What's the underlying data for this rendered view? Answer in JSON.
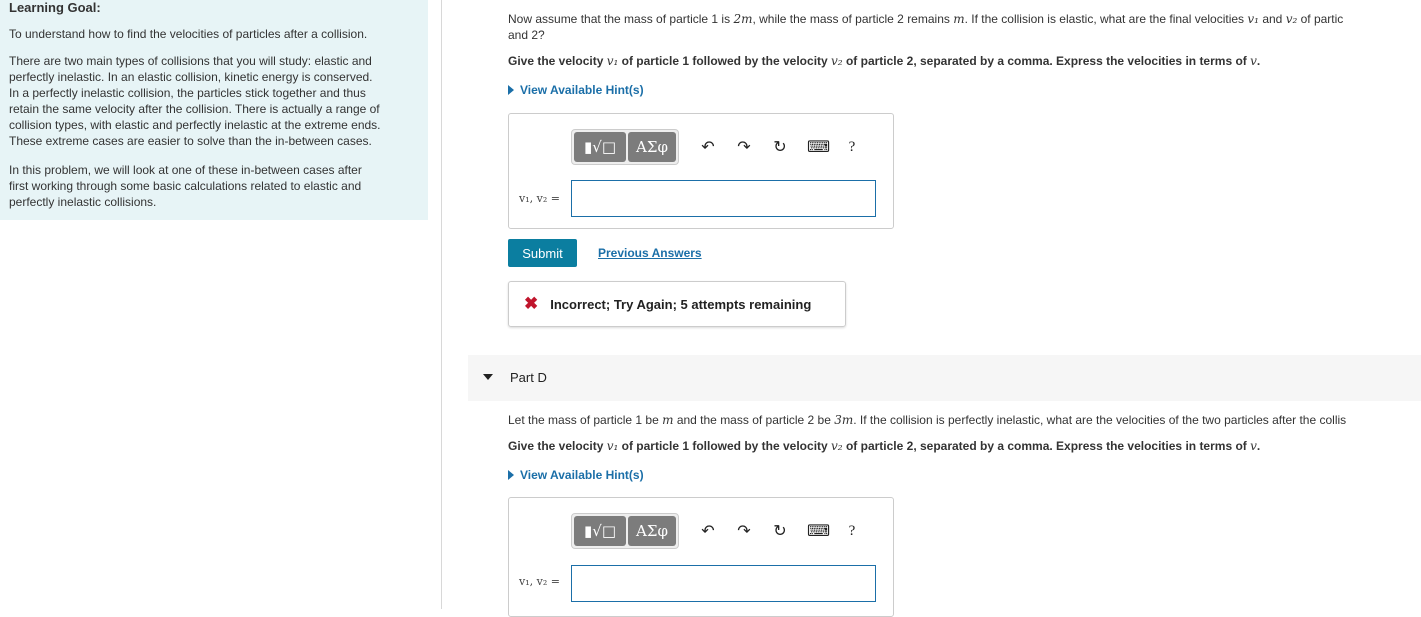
{
  "learning_goal": {
    "title": "Learning Goal:",
    "intro": "To understand how to find the velocities of particles after a collision.",
    "para1_lines": [
      "There are two main types of collisions that you will study: elastic and",
      "perfectly inelastic. In an elastic collision, kinetic energy is conserved.",
      "In a perfectly inelastic collision, the particles stick together and thus",
      "retain the same velocity after the collision. There is actually a range of",
      "collision types, with elastic and perfectly inelastic at the extreme ends.",
      "These extreme cases are easier to solve than the in-between cases."
    ],
    "para2_lines": [
      "In this problem, we will look at one of these in-between cases after",
      "first working through some basic calculations related to elastic and",
      "perfectly inelastic collisions."
    ]
  },
  "part_c": {
    "q_line1_a": "Now assume that the mass of particle 1 is ",
    "q_line1_m1": "2m",
    "q_line1_b": ", while the mass of particle 2 remains ",
    "q_line1_m2": "m",
    "q_line1_c": ". If the collision is elastic, what are the final velocities ",
    "q_line1_v1": "v₁",
    "q_line1_d": " and ",
    "q_line1_v2": "v₂",
    "q_line1_e": " of partic",
    "q_line2": "and 2?",
    "instr_a": "Give the velocity ",
    "instr_v1": "v₁",
    "instr_b": " of particle 1 followed by the velocity ",
    "instr_v2": "v₂",
    "instr_c": " of particle 2, separated by a comma. Express the velocities in terms of ",
    "instr_v": "v",
    "instr_d": ".",
    "hint": "View Available Hint(s)",
    "answer_label": "v₁, v₂ =",
    "submit": "Submit",
    "previous_answers": "Previous Answers",
    "feedback": "Incorrect; Try Again; 5 attempts remaining"
  },
  "part_d": {
    "title": "Part D",
    "q_a": "Let the mass of particle 1 be ",
    "q_m1": "m",
    "q_b": " and the mass of particle 2 be ",
    "q_m2": "3m",
    "q_c": ". If the collision is perfectly inelastic, what are the velocities of the two particles after the collis",
    "instr_a": "Give the velocity ",
    "instr_v1": "v₁",
    "instr_b": " of particle 1 followed by the velocity ",
    "instr_v2": "v₂",
    "instr_c": " of particle 2, separated by a comma. Express the velocities in terms of ",
    "instr_v": "v",
    "instr_d": ".",
    "hint": "View Available Hint(s)",
    "answer_label": "v₁, v₂ ="
  },
  "toolbar": {
    "template_glyph": "▮√□",
    "greek": "ΑΣφ",
    "undo_icon": "↶",
    "redo_icon": "↷",
    "reset_icon": "↻",
    "keyboard_icon": "⌨",
    "help": "?"
  },
  "colors": {
    "accent": "#1b6fa8",
    "submit_bg": "#0b7ea0",
    "incorrect": "#c0152c",
    "goal_bg": "#e7f4f6"
  }
}
